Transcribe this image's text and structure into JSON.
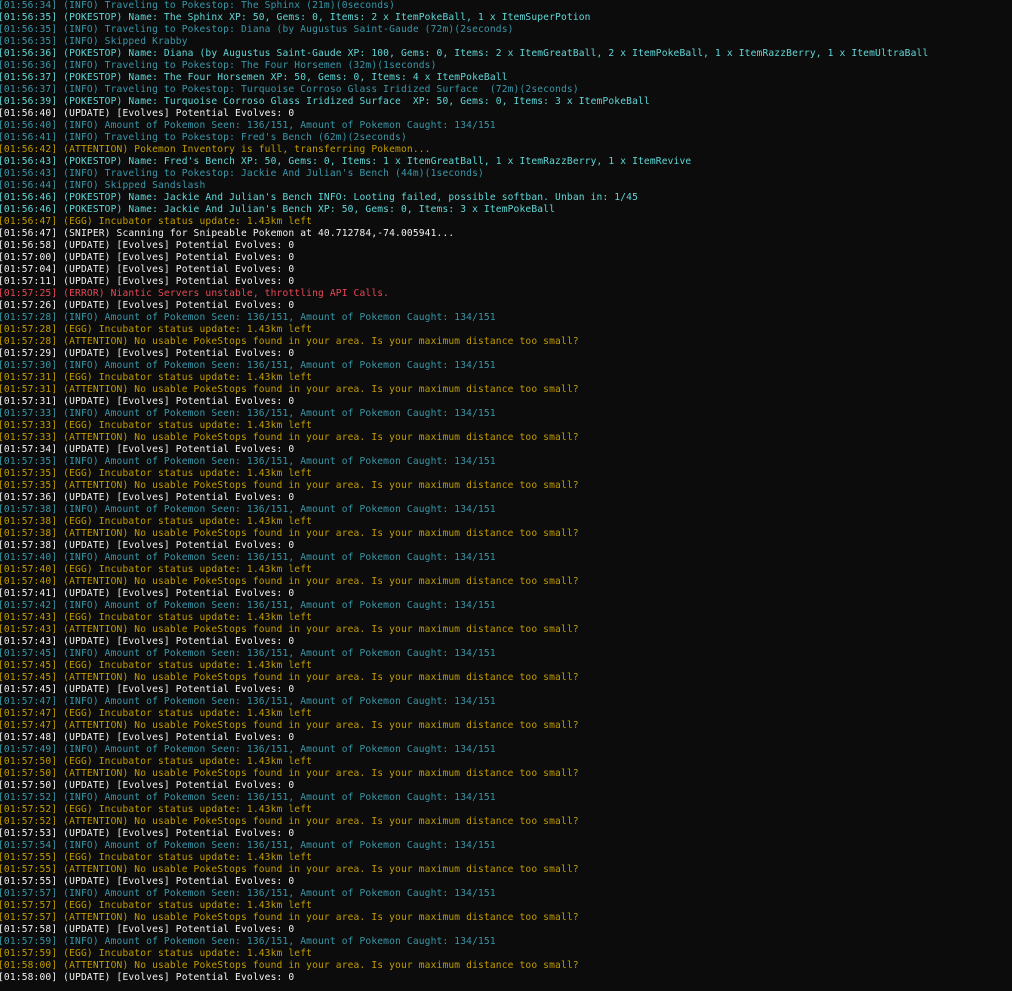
{
  "lines": [
    {
      "cls": "c-info",
      "text": "[01:56:34] (INFO) Traveling to Pokestop: The Sphinx (21m)(0seconds)"
    },
    {
      "cls": "c-pokestop",
      "text": "[01:56:35] (POKESTOP) Name: The Sphinx XP: 50, Gems: 0, Items: 2 x ItemPokeBall, 1 x ItemSuperPotion"
    },
    {
      "cls": "c-info",
      "text": "[01:56:35] (INFO) Traveling to Pokestop: Diana (by Augustus Saint-Gaude (72m)(2seconds)"
    },
    {
      "cls": "c-info",
      "text": "[01:56:35] (INFO) Skipped Krabby"
    },
    {
      "cls": "c-pokestop",
      "text": "[01:56:36] (POKESTOP) Name: Diana (by Augustus Saint-Gaude XP: 100, Gems: 0, Items: 2 x ItemGreatBall, 2 x ItemPokeBall, 1 x ItemRazzBerry, 1 x ItemUltraBall"
    },
    {
      "cls": "c-info",
      "text": "[01:56:36] (INFO) Traveling to Pokestop: The Four Horsemen (32m)(1seconds)"
    },
    {
      "cls": "c-pokestop",
      "text": "[01:56:37] (POKESTOP) Name: The Four Horsemen XP: 50, Gems: 0, Items: 4 x ItemPokeBall"
    },
    {
      "cls": "c-info",
      "text": "[01:56:37] (INFO) Traveling to Pokestop: Turquoise Corroso Glass Iridized Surface  (72m)(2seconds)"
    },
    {
      "cls": "c-pokestop",
      "text": "[01:56:39] (POKESTOP) Name: Turquoise Corroso Glass Iridized Surface  XP: 50, Gems: 0, Items: 3 x ItemPokeBall"
    },
    {
      "cls": "c-update",
      "text": "[01:56:40] (UPDATE) [Evolves] Potential Evolves: 0"
    },
    {
      "cls": "c-info",
      "text": "[01:56:40] (INFO) Amount of Pokemon Seen: 136/151, Amount of Pokemon Caught: 134/151"
    },
    {
      "cls": "c-info",
      "text": "[01:56:41] (INFO) Traveling to Pokestop: Fred's Bench (62m)(2seconds)"
    },
    {
      "cls": "c-attention",
      "text": "[01:56:42] (ATTENTION) Pokemon Inventory is full, transferring Pokemon..."
    },
    {
      "cls": "c-pokestop",
      "text": "[01:56:43] (POKESTOP) Name: Fred's Bench XP: 50, Gems: 0, Items: 1 x ItemGreatBall, 1 x ItemRazzBerry, 1 x ItemRevive"
    },
    {
      "cls": "c-info",
      "text": "[01:56:43] (INFO) Traveling to Pokestop: Jackie And Julian's Bench (44m)(1seconds)"
    },
    {
      "cls": "c-info",
      "text": "[01:56:44] (INFO) Skipped Sandslash"
    },
    {
      "cls": "c-pokestop",
      "text": "[01:56:46] (POKESTOP) Name: Jackie And Julian's Bench INFO: Looting failed, possible softban. Unban in: 1/45"
    },
    {
      "cls": "c-pokestop",
      "text": "[01:56:46] (POKESTOP) Name: Jackie And Julian's Bench XP: 50, Gems: 0, Items: 3 x ItemPokeBall"
    },
    {
      "cls": "c-egg",
      "text": "[01:56:47] (EGG) Incubator status update: 1.43km left"
    },
    {
      "cls": "c-sniper",
      "text": "[01:56:47] (SNIPER) Scanning for Snipeable Pokemon at 40.712784,-74.005941..."
    },
    {
      "cls": "c-update",
      "text": "[01:56:58] (UPDATE) [Evolves] Potential Evolves: 0"
    },
    {
      "cls": "c-update",
      "text": "[01:57:00] (UPDATE) [Evolves] Potential Evolves: 0"
    },
    {
      "cls": "c-update",
      "text": "[01:57:04] (UPDATE) [Evolves] Potential Evolves: 0"
    },
    {
      "cls": "c-update",
      "text": "[01:57:11] (UPDATE) [Evolves] Potential Evolves: 0"
    },
    {
      "cls": "c-error",
      "text": "[01:57:25] (ERROR) Niantic Servers unstable, throttling API Calls."
    },
    {
      "cls": "c-update",
      "text": "[01:57:26] (UPDATE) [Evolves] Potential Evolves: 0"
    },
    {
      "cls": "c-info",
      "text": "[01:57:28] (INFO) Amount of Pokemon Seen: 136/151, Amount of Pokemon Caught: 134/151"
    },
    {
      "cls": "c-egg",
      "text": "[01:57:28] (EGG) Incubator status update: 1.43km left"
    },
    {
      "cls": "c-attention",
      "text": "[01:57:28] (ATTENTION) No usable PokeStops found in your area. Is your maximum distance too small?"
    },
    {
      "cls": "c-update",
      "text": "[01:57:29] (UPDATE) [Evolves] Potential Evolves: 0"
    },
    {
      "cls": "c-info",
      "text": "[01:57:30] (INFO) Amount of Pokemon Seen: 136/151, Amount of Pokemon Caught: 134/151"
    },
    {
      "cls": "c-egg",
      "text": "[01:57:31] (EGG) Incubator status update: 1.43km left"
    },
    {
      "cls": "c-attention",
      "text": "[01:57:31] (ATTENTION) No usable PokeStops found in your area. Is your maximum distance too small?"
    },
    {
      "cls": "c-update",
      "text": "[01:57:31] (UPDATE) [Evolves] Potential Evolves: 0"
    },
    {
      "cls": "c-info",
      "text": "[01:57:33] (INFO) Amount of Pokemon Seen: 136/151, Amount of Pokemon Caught: 134/151"
    },
    {
      "cls": "c-egg",
      "text": "[01:57:33] (EGG) Incubator status update: 1.43km left"
    },
    {
      "cls": "c-attention",
      "text": "[01:57:33] (ATTENTION) No usable PokeStops found in your area. Is your maximum distance too small?"
    },
    {
      "cls": "c-update",
      "text": "[01:57:34] (UPDATE) [Evolves] Potential Evolves: 0"
    },
    {
      "cls": "c-info",
      "text": "[01:57:35] (INFO) Amount of Pokemon Seen: 136/151, Amount of Pokemon Caught: 134/151"
    },
    {
      "cls": "c-egg",
      "text": "[01:57:35] (EGG) Incubator status update: 1.43km left"
    },
    {
      "cls": "c-attention",
      "text": "[01:57:35] (ATTENTION) No usable PokeStops found in your area. Is your maximum distance too small?"
    },
    {
      "cls": "c-update",
      "text": "[01:57:36] (UPDATE) [Evolves] Potential Evolves: 0"
    },
    {
      "cls": "c-info",
      "text": "[01:57:38] (INFO) Amount of Pokemon Seen: 136/151, Amount of Pokemon Caught: 134/151"
    },
    {
      "cls": "c-egg",
      "text": "[01:57:38] (EGG) Incubator status update: 1.43km left"
    },
    {
      "cls": "c-attention",
      "text": "[01:57:38] (ATTENTION) No usable PokeStops found in your area. Is your maximum distance too small?"
    },
    {
      "cls": "c-update",
      "text": "[01:57:38] (UPDATE) [Evolves] Potential Evolves: 0"
    },
    {
      "cls": "c-info",
      "text": "[01:57:40] (INFO) Amount of Pokemon Seen: 136/151, Amount of Pokemon Caught: 134/151"
    },
    {
      "cls": "c-egg",
      "text": "[01:57:40] (EGG) Incubator status update: 1.43km left"
    },
    {
      "cls": "c-attention",
      "text": "[01:57:40] (ATTENTION) No usable PokeStops found in your area. Is your maximum distance too small?"
    },
    {
      "cls": "c-update",
      "text": "[01:57:41] (UPDATE) [Evolves] Potential Evolves: 0"
    },
    {
      "cls": "c-info",
      "text": "[01:57:42] (INFO) Amount of Pokemon Seen: 136/151, Amount of Pokemon Caught: 134/151"
    },
    {
      "cls": "c-egg",
      "text": "[01:57:43] (EGG) Incubator status update: 1.43km left"
    },
    {
      "cls": "c-attention",
      "text": "[01:57:43] (ATTENTION) No usable PokeStops found in your area. Is your maximum distance too small?"
    },
    {
      "cls": "c-update",
      "text": "[01:57:43] (UPDATE) [Evolves] Potential Evolves: 0"
    },
    {
      "cls": "c-info",
      "text": "[01:57:45] (INFO) Amount of Pokemon Seen: 136/151, Amount of Pokemon Caught: 134/151"
    },
    {
      "cls": "c-egg",
      "text": "[01:57:45] (EGG) Incubator status update: 1.43km left"
    },
    {
      "cls": "c-attention",
      "text": "[01:57:45] (ATTENTION) No usable PokeStops found in your area. Is your maximum distance too small?"
    },
    {
      "cls": "c-update",
      "text": "[01:57:45] (UPDATE) [Evolves] Potential Evolves: 0"
    },
    {
      "cls": "c-info",
      "text": "[01:57:47] (INFO) Amount of Pokemon Seen: 136/151, Amount of Pokemon Caught: 134/151"
    },
    {
      "cls": "c-egg",
      "text": "[01:57:47] (EGG) Incubator status update: 1.43km left"
    },
    {
      "cls": "c-attention",
      "text": "[01:57:47] (ATTENTION) No usable PokeStops found in your area. Is your maximum distance too small?"
    },
    {
      "cls": "c-update",
      "text": "[01:57:48] (UPDATE) [Evolves] Potential Evolves: 0"
    },
    {
      "cls": "c-info",
      "text": "[01:57:49] (INFO) Amount of Pokemon Seen: 136/151, Amount of Pokemon Caught: 134/151"
    },
    {
      "cls": "c-egg",
      "text": "[01:57:50] (EGG) Incubator status update: 1.43km left"
    },
    {
      "cls": "c-attention",
      "text": "[01:57:50] (ATTENTION) No usable PokeStops found in your area. Is your maximum distance too small?"
    },
    {
      "cls": "c-update",
      "text": "[01:57:50] (UPDATE) [Evolves] Potential Evolves: 0"
    },
    {
      "cls": "c-info",
      "text": "[01:57:52] (INFO) Amount of Pokemon Seen: 136/151, Amount of Pokemon Caught: 134/151"
    },
    {
      "cls": "c-egg",
      "text": "[01:57:52] (EGG) Incubator status update: 1.43km left"
    },
    {
      "cls": "c-attention",
      "text": "[01:57:52] (ATTENTION) No usable PokeStops found in your area. Is your maximum distance too small?"
    },
    {
      "cls": "c-update",
      "text": "[01:57:53] (UPDATE) [Evolves] Potential Evolves: 0"
    },
    {
      "cls": "c-info",
      "text": "[01:57:54] (INFO) Amount of Pokemon Seen: 136/151, Amount of Pokemon Caught: 134/151"
    },
    {
      "cls": "c-egg",
      "text": "[01:57:55] (EGG) Incubator status update: 1.43km left"
    },
    {
      "cls": "c-attention",
      "text": "[01:57:55] (ATTENTION) No usable PokeStops found in your area. Is your maximum distance too small?"
    },
    {
      "cls": "c-update",
      "text": "[01:57:55] (UPDATE) [Evolves] Potential Evolves: 0"
    },
    {
      "cls": "c-info",
      "text": "[01:57:57] (INFO) Amount of Pokemon Seen: 136/151, Amount of Pokemon Caught: 134/151"
    },
    {
      "cls": "c-egg",
      "text": "[01:57:57] (EGG) Incubator status update: 1.43km left"
    },
    {
      "cls": "c-attention",
      "text": "[01:57:57] (ATTENTION) No usable PokeStops found in your area. Is your maximum distance too small?"
    },
    {
      "cls": "c-update",
      "text": "[01:57:58] (UPDATE) [Evolves] Potential Evolves: 0"
    },
    {
      "cls": "c-info",
      "text": "[01:57:59] (INFO) Amount of Pokemon Seen: 136/151, Amount of Pokemon Caught: 134/151"
    },
    {
      "cls": "c-egg",
      "text": "[01:57:59] (EGG) Incubator status update: 1.43km left"
    },
    {
      "cls": "c-attention",
      "text": "[01:58:00] (ATTENTION) No usable PokeStops found in your area. Is your maximum distance too small?"
    },
    {
      "cls": "c-update",
      "text": "[01:58:00] (UPDATE) [Evolves] Potential Evolves: 0"
    }
  ]
}
